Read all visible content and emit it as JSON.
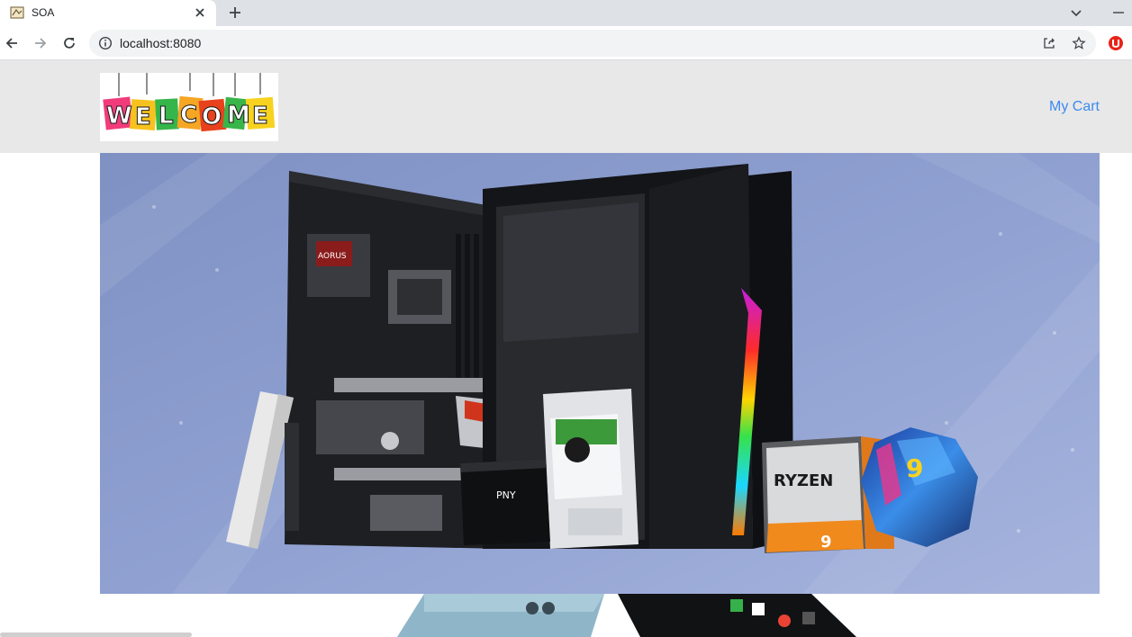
{
  "browser": {
    "tab": {
      "title": "SOA"
    },
    "address_bar": {
      "url": "localhost:8080"
    },
    "icons": [
      "favicon-icon",
      "close-icon",
      "plus-icon",
      "chevron-down-icon",
      "minimize-icon",
      "back-icon",
      "forward-icon",
      "reload-icon",
      "info-icon",
      "share-icon",
      "star-icon",
      "extension-icon"
    ]
  },
  "header": {
    "logo": {
      "letters": [
        "W",
        "E",
        "L",
        "C",
        "O",
        "M",
        "E"
      ]
    },
    "cart_label": "My Cart",
    "colors": {
      "background": "#e8e8e8",
      "link": "#3c8af0"
    }
  },
  "hero": {
    "description_items": [
      "motherboard",
      "memory-stick",
      "ssd",
      "hard-drive",
      "pc-case",
      "cpu-box-ryzen",
      "cpu-box-core"
    ],
    "ryzen_text": "RYZEN",
    "pny_text": "PNY",
    "ryzen_badge": "9",
    "core_badge": "9",
    "colors": {
      "background": "#8a9ccd"
    }
  }
}
